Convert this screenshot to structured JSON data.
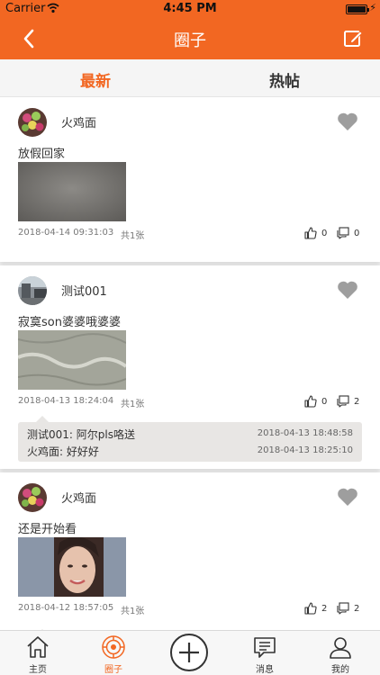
{
  "status_bar": {
    "carrier": "Carrier",
    "time": "4:45 PM",
    "charging_glyph": "⚡"
  },
  "nav": {
    "title": "圈子",
    "back_icon": "chevron-left-icon",
    "edit_icon": "edit-icon"
  },
  "tabs": [
    {
      "label": "最新",
      "active": true
    },
    {
      "label": "热帖",
      "active": false
    }
  ],
  "posts": [
    {
      "username": "火鸡面",
      "text": "放假回家",
      "date": "2018-04-14 09:31:03",
      "image_count": "共1张",
      "likes": "0",
      "comments": "0",
      "replies": []
    },
    {
      "username": "测试001",
      "text": "寂寞son婆婆哦婆婆",
      "date": "2018-04-13 18:24:04",
      "image_count": "共1张",
      "likes": "0",
      "comments": "2",
      "replies": [
        {
          "text": "测试001: 阿尔pls咯送",
          "time": "2018-04-13 18:48:58"
        },
        {
          "text": "火鸡面: 好好好",
          "time": "2018-04-13 18:25:10"
        }
      ]
    },
    {
      "username": "火鸡面",
      "text": "还是开始看",
      "date": "2018-04-12 18:57:05",
      "image_count": "共1张",
      "likes": "2",
      "comments": "2",
      "replies": []
    }
  ],
  "tab_bar": [
    {
      "label": "主页",
      "icon": "home-icon",
      "active": false
    },
    {
      "label": "圈子",
      "icon": "circle-target-icon",
      "active": true
    },
    {
      "label": "",
      "icon": "add-icon",
      "active": false
    },
    {
      "label": "消息",
      "icon": "message-icon",
      "active": false
    },
    {
      "label": "我的",
      "icon": "profile-icon",
      "active": false
    }
  ],
  "colors": {
    "accent": "#f26722",
    "heart": "#9e9e9e",
    "comment_bg": "#e8e6e4"
  }
}
